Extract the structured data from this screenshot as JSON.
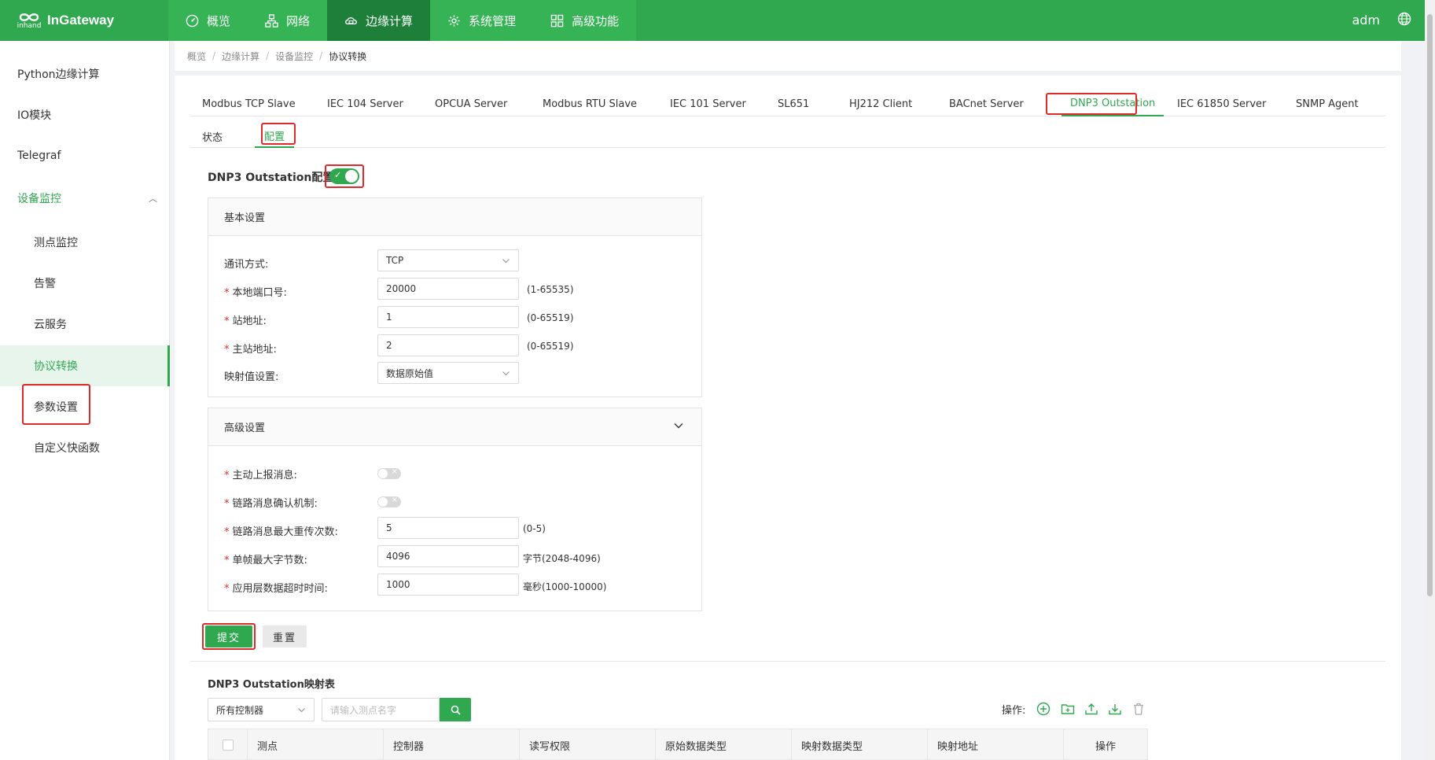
{
  "brand": {
    "mark": "inhand",
    "name": "InGateway"
  },
  "topnav": [
    {
      "label": "概览",
      "icon": "dashboard-icon"
    },
    {
      "label": "网络",
      "icon": "network-icon"
    },
    {
      "label": "边缘计算",
      "icon": "edge-computing-icon",
      "active": true
    },
    {
      "label": "系统管理",
      "icon": "gear-icon"
    },
    {
      "label": "高级功能",
      "icon": "grid-icon"
    }
  ],
  "user": "adm",
  "sidebar": {
    "items": [
      {
        "label": "Python边缘计算"
      },
      {
        "label": "IO模块"
      },
      {
        "label": "Telegraf"
      },
      {
        "label": "设备监控",
        "expanded": true
      },
      {
        "label": "测点监控"
      },
      {
        "label": "告警"
      },
      {
        "label": "云服务"
      },
      {
        "label": "协议转换",
        "active": true
      },
      {
        "label": "参数设置"
      },
      {
        "label": "自定义快函数"
      }
    ]
  },
  "breadcrumb": [
    "概览",
    "边缘计算",
    "设备监控",
    "协议转换"
  ],
  "protocol_tabs": [
    "Modbus TCP Slave",
    "IEC 104 Server",
    "OPCUA Server",
    "Modbus RTU Slave",
    "IEC 101 Server",
    "SL651",
    "HJ212 Client",
    "BACnet Server",
    "DNP3 Outstation",
    "IEC 61850 Server",
    "SNMP Agent"
  ],
  "active_protocol_tab": "DNP3 Outstation",
  "sub_tabs": [
    "状态",
    "配置"
  ],
  "active_sub_tab": "配置",
  "config": {
    "title": "DNP3 Outstation配置",
    "enabled": true,
    "basic": {
      "title": "基本设置",
      "comm_mode": {
        "label": "通讯方式:",
        "value": "TCP"
      },
      "local_port": {
        "label": "本地端口号:",
        "value": "20000",
        "hint": "(1-65535)"
      },
      "station_addr": {
        "label": "站地址:",
        "value": "1",
        "hint": "(0-65519)"
      },
      "master_addr": {
        "label": "主站地址:",
        "value": "2",
        "hint": "(0-65519)"
      },
      "mapping": {
        "label": "映射值设置:",
        "value": "数据原始值"
      }
    },
    "advanced": {
      "title": "高级设置",
      "unsolicited": {
        "label": "主动上报消息:",
        "enabled": false
      },
      "link_confirm": {
        "label": "链路消息确认机制:",
        "enabled": false
      },
      "max_retries": {
        "label": "链路消息最大重传次数:",
        "value": "5",
        "hint": "(0-5)"
      },
      "max_frame": {
        "label": "单帧最大字节数:",
        "value": "4096",
        "hint": "字节(2048-4096)"
      },
      "app_timeout": {
        "label": "应用层数据超时时间:",
        "value": "1000",
        "hint": "毫秒(1000-10000)"
      }
    },
    "submit_label": "提交",
    "reset_label": "重置"
  },
  "mapping_table": {
    "title": "DNP3 Outstation映射表",
    "controller_filter": "所有控制器",
    "search_placeholder": "请输入测点名字",
    "ops_label": "操作:",
    "columns": [
      "测点",
      "控制器",
      "读写权限",
      "原始数据类型",
      "映射数据类型",
      "映射地址",
      "操作"
    ]
  },
  "colors": {
    "brand_green": "#2fa84f",
    "highlight_red": "#e02a2a"
  }
}
